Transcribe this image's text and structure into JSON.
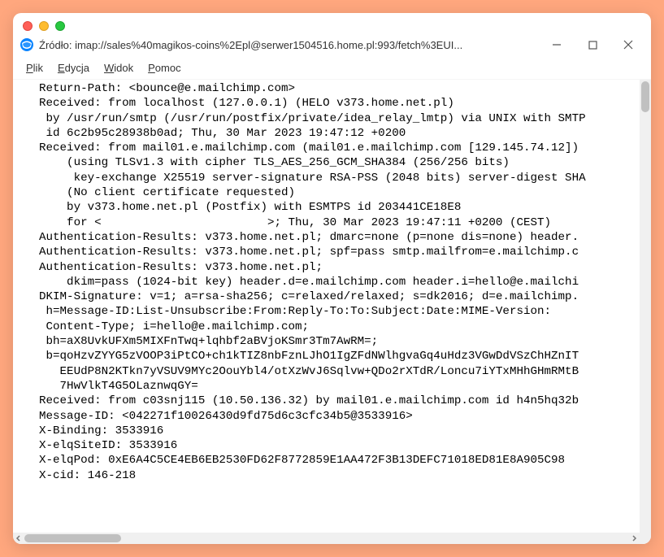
{
  "window": {
    "title": "Źródło: imap://sales%40magikos-coins%2Epl@serwer1504516.home.pl:993/fetch%3EUI..."
  },
  "menubar": [
    {
      "underline": "P",
      "rest": "lik"
    },
    {
      "underline": "E",
      "rest": "dycja"
    },
    {
      "underline": "W",
      "rest": "idok"
    },
    {
      "underline": "P",
      "rest": "omoc"
    }
  ],
  "source": "Return-Path: <bounce@e.mailchimp.com>\nReceived: from localhost (127.0.0.1) (HELO v373.home.net.pl)\n by /usr/run/smtp (/usr/run/postfix/private/idea_relay_lmtp) via UNIX with SMTP\n id 6c2b95c28938b0ad; Thu, 30 Mar 2023 19:47:12 +0200\nReceived: from mail01.e.mailchimp.com (mail01.e.mailchimp.com [129.145.74.12])\n    (using TLSv1.3 with cipher TLS_AES_256_GCM_SHA384 (256/256 bits)\n     key-exchange X25519 server-signature RSA-PSS (2048 bits) server-digest SHA\n    (No client certificate requested)\n    by v373.home.net.pl (Postfix) with ESMTPS id 203441CE18E8\n    for <                        >; Thu, 30 Mar 2023 19:47:11 +0200 (CEST)\nAuthentication-Results: v373.home.net.pl; dmarc=none (p=none dis=none) header.\nAuthentication-Results: v373.home.net.pl; spf=pass smtp.mailfrom=e.mailchimp.c\nAuthentication-Results: v373.home.net.pl;\n    dkim=pass (1024-bit key) header.d=e.mailchimp.com header.i=hello@e.mailchi\nDKIM-Signature: v=1; a=rsa-sha256; c=relaxed/relaxed; s=dk2016; d=e.mailchimp.\n h=Message-ID:List-Unsubscribe:From:Reply-To:To:Subject:Date:MIME-Version:\n Content-Type; i=hello@e.mailchimp.com;\n bh=aX8UvkUFXm5MIXFnTwq+lqhbf2aBVjoKSmr3Tm7AwRM=;\n b=qoHzvZYYG5zVOOP3iPtCO+ch1kTIZ8nbFznLJhO1IgZFdNWlhgvaGq4uHdz3VGwDdVSzChHZnIT\n   EEUdP8N2KTkn7yVSUV9MYc2OouYbl4/otXzWvJ6Sqlvw+QDo2rXTdR/Loncu7iYTxMHhGHmRMtB\n   7HwVlkT4G5OLaznwqGY=\nReceived: from c03snj115 (10.50.136.32) by mail01.e.mailchimp.com id h4n5hq32b\nMessage-ID: <042271f10026430d9fd75d6c3cfc34b5@3533916>\nX-Binding: 3533916\nX-elqSiteID: 3533916\nX-elqPod: 0xE6A4C5CE4EB6EB2530FD62F8772859E1AA472F3B13DEFC71018ED81E8A905C98\nX-cid: 146-218"
}
